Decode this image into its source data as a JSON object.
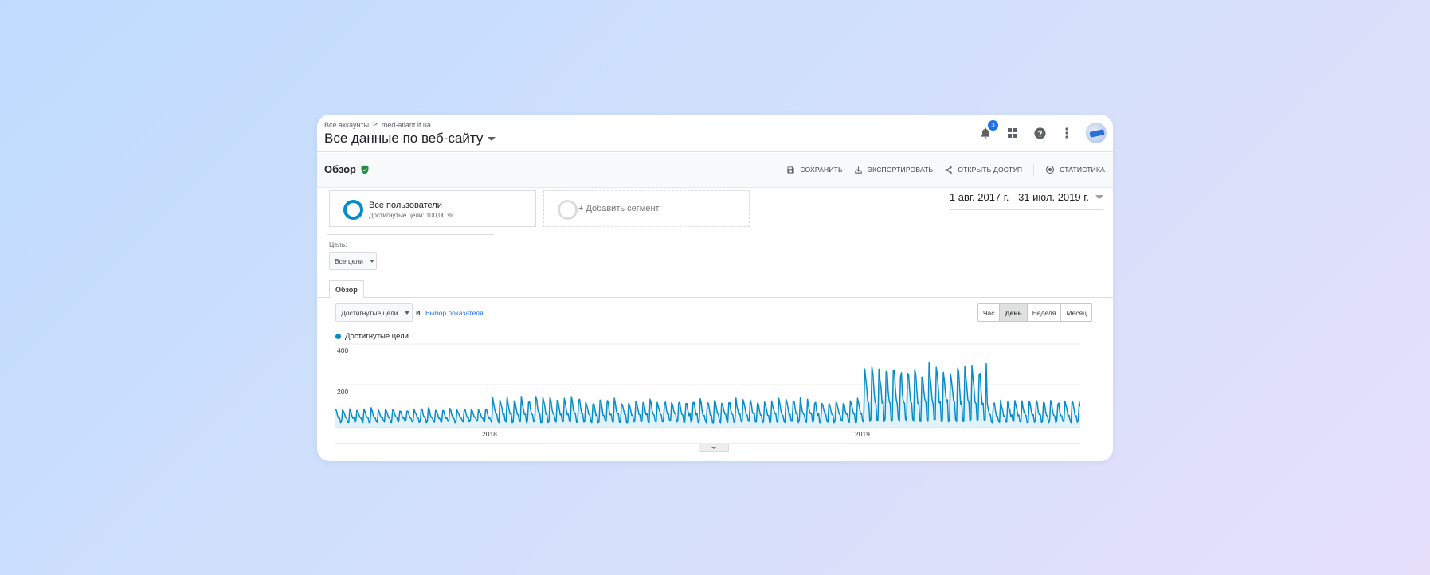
{
  "breadcrumb": {
    "accounts": "Все аккаунты",
    "separator": ">",
    "property": "med-atlant.if.ua"
  },
  "view_title": "Все данные по веб-сайту",
  "notifications": {
    "count": "3"
  },
  "report": {
    "title": "Обзор",
    "actions": {
      "save": "СОХРАНИТЬ",
      "export": "ЭКСПОРТИРОВАТЬ",
      "share": "ОТКРЫТЬ ДОСТУП",
      "insights": "СТАТИСТИКА"
    }
  },
  "segments": {
    "active": {
      "name": "Все пользователи",
      "subtitle": "Достигнутые цели: 100,00 %"
    },
    "add_label": "+ Добавить сегмент"
  },
  "date_range": "1 авг. 2017 г. - 31 июл. 2019 г.",
  "goal": {
    "label": "Цель:",
    "selected": "Все цели"
  },
  "tab": "Обзор",
  "metric": {
    "selected": "Достигнутые цели",
    "and": "и",
    "choose_link": "Выбор показателя"
  },
  "granularity": [
    "Час",
    "День",
    "Неделя",
    "Месяц"
  ],
  "granularity_active": "День",
  "colors": {
    "series": "#058dc7",
    "fill": "#e1f2fa",
    "accent": "#1a73e8",
    "verified": "#1e8e3e"
  },
  "chart_data": {
    "type": "line",
    "title": "",
    "series": [
      {
        "name": "Достигнутые цели"
      }
    ],
    "y_ticks": [
      "200",
      "400"
    ],
    "x_tick_labels": [
      "2018",
      "2019"
    ],
    "x_range": [
      "2017-08-01",
      "2019-07-31"
    ],
    "ylim": [
      0,
      400
    ],
    "grid": true,
    "granularity": "day",
    "weekly_profile": [
      {
        "period": "2017-08 — 2017-12",
        "low": 20,
        "high": 95
      },
      {
        "period": "2018-01 — 2018-03",
        "low": 20,
        "high": 150
      },
      {
        "period": "2018-04 — 2018-12",
        "low": 20,
        "high": 140
      },
      {
        "period": "2019-01 — 2019-04",
        "low": 25,
        "high": 310
      },
      {
        "period": "2019-05 — 2019-07",
        "low": 20,
        "high": 130
      }
    ],
    "peak": {
      "date": "2019-02",
      "value": 310
    }
  }
}
